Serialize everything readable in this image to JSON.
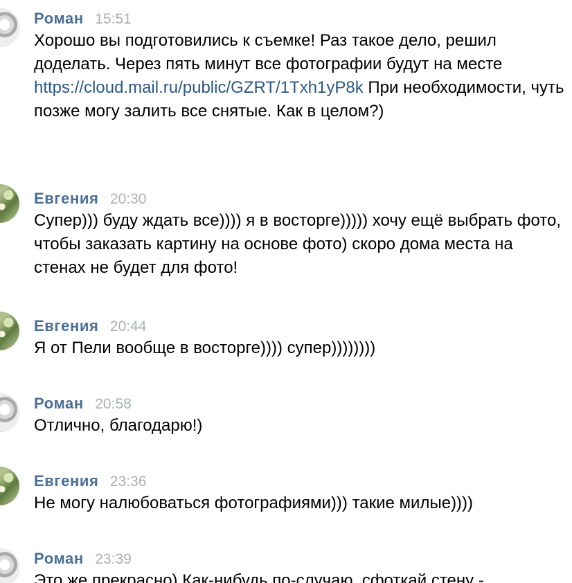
{
  "messages": [
    {
      "author": "Роман",
      "time": "15:51",
      "text_before": "Хорошо вы подготовились к съемке! Раз такое дело, решил доделать. Через пять минут все фотографии будут на месте ",
      "link": "https://cloud.mail.ru/public/GZRT/1Txh1yP8k",
      "text_after": " При необходимости, чуть позже могу залить все снятые. Как в целом?)"
    },
    {
      "author": "Евгения",
      "time": "20:30",
      "text": "Супер))) буду ждать все)))) я в восторге))))) хочу ещё выбрать фото, чтобы заказать картину на основе фото) скоро дома места на стенах не будет для фото!"
    },
    {
      "author": "Евгения",
      "time": "20:44",
      "text": "Я от Пели вообще в восторге)))) супер))))))))"
    },
    {
      "author": "Роман",
      "time": "20:58",
      "text": "Отлично, благодарю!)"
    },
    {
      "author": "Евгения",
      "time": "23:36",
      "text": "Не могу налюбоваться фотографиями))) такие милые))))"
    },
    {
      "author": "Роман",
      "time": "23:39",
      "text": "Это же прекрасно) Как-нибудь по-случаю, сфоткай стену -"
    }
  ],
  "colors": {
    "author": "#4a6e95",
    "time": "#a8b0b9",
    "link": "#2a5885",
    "text": "#000000"
  }
}
